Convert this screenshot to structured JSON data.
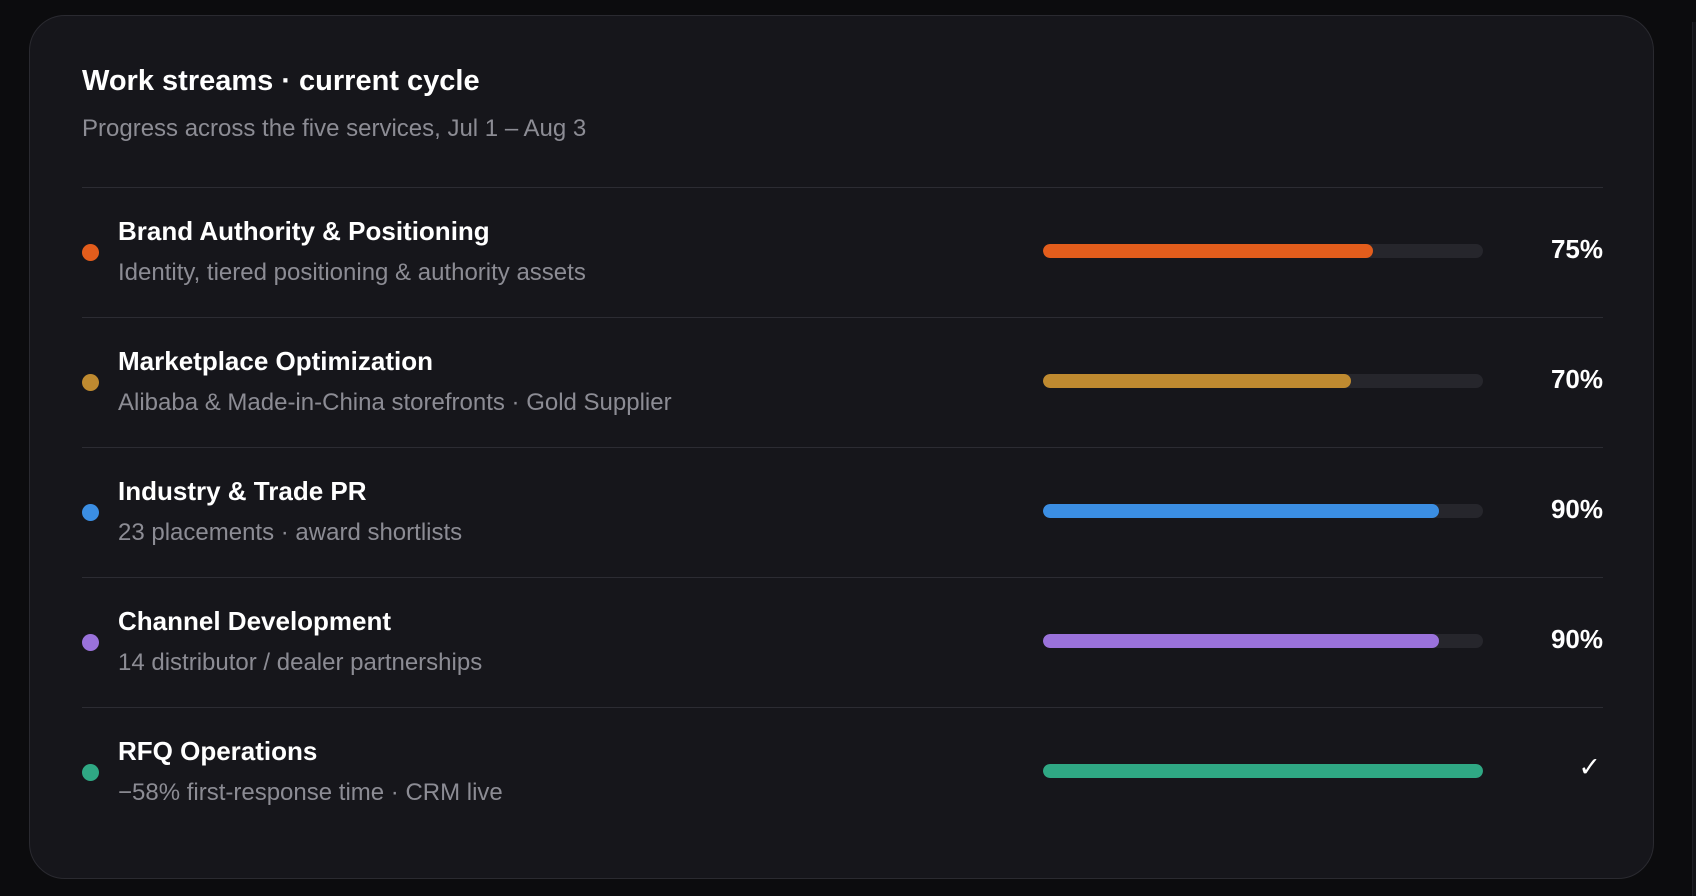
{
  "card": {
    "title": "Work streams · current cycle",
    "subtitle": "Progress across the five services, Jul 1 – Aug 3"
  },
  "streams": [
    {
      "name": "Brand Authority & Positioning",
      "description": "Identity, tiered positioning & authority assets",
      "progress": 0.75,
      "status_label": "75%",
      "color": "#e35d1c"
    },
    {
      "name": "Marketplace Optimization",
      "description": "Alibaba & Made-in-China storefronts · Gold Supplier",
      "progress": 0.7,
      "status_label": "70%",
      "color": "#bf8a30"
    },
    {
      "name": "Industry & Trade PR",
      "description": "23 placements · award shortlists",
      "progress": 0.9,
      "status_label": "90%",
      "color": "#3b8ee3"
    },
    {
      "name": "Channel Development",
      "description": "14 distributor / dealer partnerships",
      "progress": 0.9,
      "status_label": "90%",
      "color": "#9a72db"
    },
    {
      "name": "RFQ Operations",
      "description": "−58% first-response time · CRM live",
      "progress": 1.0,
      "status_label": "✓",
      "color": "#2fa884"
    }
  ]
}
